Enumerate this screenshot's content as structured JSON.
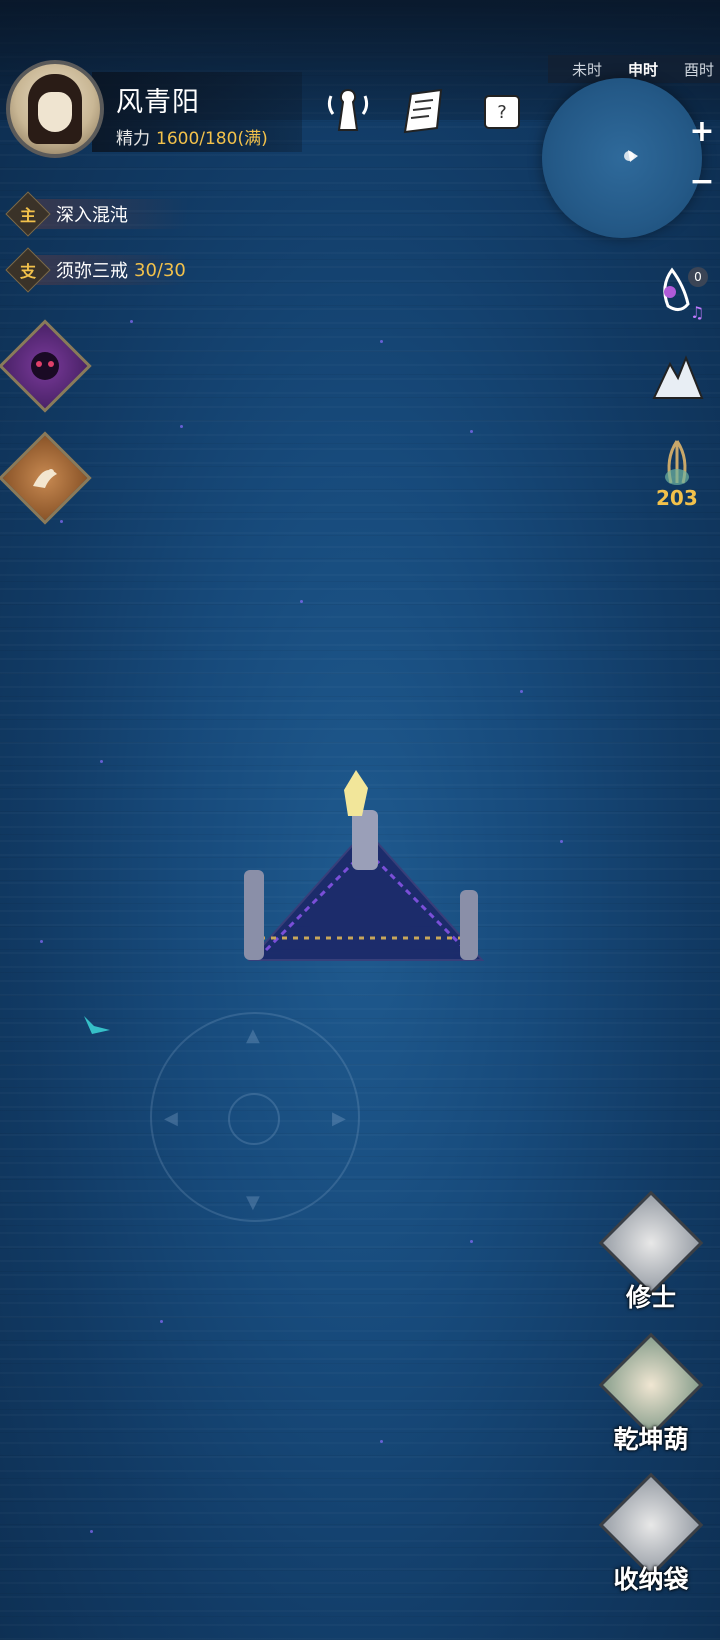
{
  "player": {
    "name": "风青阳",
    "stamina_label": "精力",
    "stamina_value": "1600/180(满)"
  },
  "clock": {
    "slots": [
      "未时",
      "申时",
      "酉时"
    ],
    "current": "申时"
  },
  "quests": [
    {
      "tag": "主",
      "title": "深入混沌",
      "progress": ""
    },
    {
      "tag": "支",
      "title": "须弥三戒",
      "progress": "30/30"
    }
  ],
  "side": {
    "notification_count": "0",
    "resource_count": "203"
  },
  "menu": {
    "cultivator": "修士",
    "gourd": "乾坤葫",
    "bag": "收纳袋"
  },
  "colors": {
    "accent_gold": "#f2c14b",
    "sea": "#174a7b"
  }
}
